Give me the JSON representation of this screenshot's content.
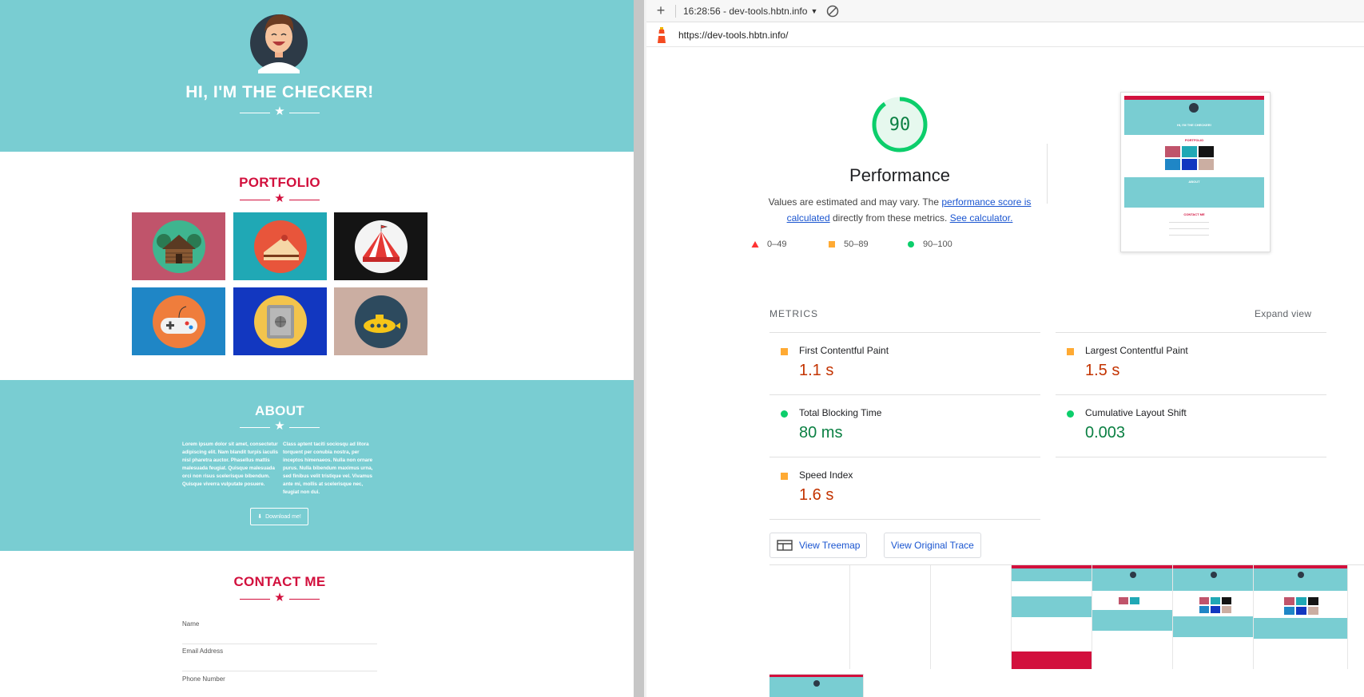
{
  "site": {
    "hero_title": "HI, I'M THE CHECKER!",
    "portfolio_title": "PORTFOLIO",
    "portfolio": [
      {
        "name": "cabin",
        "bg": "#c0546b"
      },
      {
        "name": "cake",
        "bg": "#20a8b5"
      },
      {
        "name": "circus",
        "bg": "#141414"
      },
      {
        "name": "game-controller",
        "bg": "#1f86c6"
      },
      {
        "name": "safe",
        "bg": "#1237c0"
      },
      {
        "name": "submarine",
        "bg": "#cbaea2"
      }
    ],
    "about_title": "ABOUT",
    "about_left": "Lorem ipsum dolor sit amet, consectetur adipiscing elit. Nam blandit turpis iaculis nisl pharetra auctor. Phasellus mattis malesuada feugiat. Quisque malesuada orci non risus scelerisque bibendum. Quisque viverra vulputate posuere.",
    "about_right": "Class aptent taciti sociosqu ad litora torquent per conubia nostra, per inceptos himenaeos. Nulla non ornare purus. Nulla bibendum maximus urna, sed finibus velit tristique vel. Vivamus ante mi, mollis at scelerisque nec, feugiat non dui.",
    "download_label": "Download me!",
    "contact_title": "CONTACT ME",
    "fields": [
      "Name",
      "Email Address",
      "Phone Number"
    ],
    "colors": {
      "teal": "#79cdd2",
      "accent": "#d2103d"
    }
  },
  "devtools": {
    "report_label": "16:28:56 - dev-tools.hbtn.info",
    "url": "https://dev-tools.hbtn.info/",
    "score": "90",
    "score_fraction": 0.9,
    "category": "Performance",
    "desc_pre": "Values are estimated and may vary. The ",
    "desc_link1": "performance score is calculated",
    "desc_mid": " directly from these metrics. ",
    "desc_link2": "See calculator.",
    "legend": [
      {
        "label": "0–49",
        "color": "#ff3333",
        "shape": "triangle"
      },
      {
        "label": "50–89",
        "color": "#ffaa33",
        "shape": "square"
      },
      {
        "label": "90–100",
        "color": "#0cce6b",
        "shape": "circle"
      }
    ],
    "metrics_title": "METRICS",
    "expand_label": "Expand view",
    "metrics": [
      {
        "label": "First Contentful Paint",
        "value": "1.1 s",
        "status": "average"
      },
      {
        "label": "Largest Contentful Paint",
        "value": "1.5 s",
        "status": "average"
      },
      {
        "label": "Total Blocking Time",
        "value": "80 ms",
        "status": "pass"
      },
      {
        "label": "Cumulative Layout Shift",
        "value": "0.003",
        "status": "pass"
      },
      {
        "label": "Speed Index",
        "value": "1.6 s",
        "status": "average"
      }
    ],
    "treemap_label": "View Treemap",
    "trace_label": "View Original Trace",
    "thumbnail_text": {
      "hero": "HI, I'M THE CHECKER!",
      "portfolio": "PORTFOLIO",
      "about": "ABOUT",
      "contact": "CONTACT ME"
    }
  }
}
